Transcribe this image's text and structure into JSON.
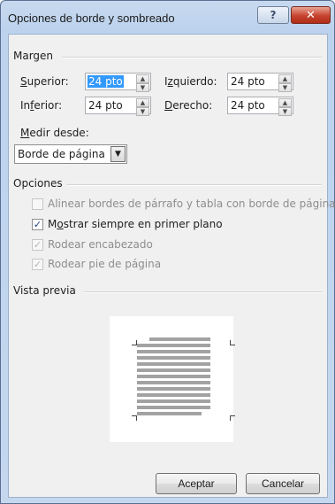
{
  "window": {
    "title": "Opciones de borde y sombreado",
    "help_glyph": "?",
    "close_glyph": "✕"
  },
  "margin_group": {
    "label": "Margen",
    "superior": {
      "label_ul": "S",
      "label_rest": "uperior:",
      "value": "24 pto"
    },
    "inferior": {
      "label_pre": "In",
      "label_ul": "f",
      "label_rest": "erior:",
      "value": "24 pto"
    },
    "izquierdo": {
      "label_pre": "I",
      "label_ul": "z",
      "label_rest": "quierdo:",
      "value": "24 pto"
    },
    "derecho": {
      "label_ul": "D",
      "label_rest": "erecho:",
      "value": "24 pto"
    },
    "measure_label_ul": "M",
    "measure_label_rest": "edir desde:",
    "measure_value": "Borde de página"
  },
  "options_group": {
    "label": "Opciones",
    "items": [
      {
        "label": "Alinear bordes de párrafo y tabla con borde de página",
        "checked": false,
        "enabled": false
      },
      {
        "label_pre": "M",
        "label_ul": "o",
        "label_rest": "strar siempre en primer plano",
        "checked": true,
        "enabled": true
      },
      {
        "label": "Rodear encabezado",
        "checked": true,
        "enabled": false
      },
      {
        "label": "Rodear pie de página",
        "checked": true,
        "enabled": false
      }
    ]
  },
  "preview_group": {
    "label": "Vista previa"
  },
  "buttons": {
    "ok": "Aceptar",
    "cancel": "Cancelar"
  },
  "icons": {
    "spin_up": "▲",
    "spin_down": "▼",
    "dropdown": "▼",
    "check": "✓"
  }
}
